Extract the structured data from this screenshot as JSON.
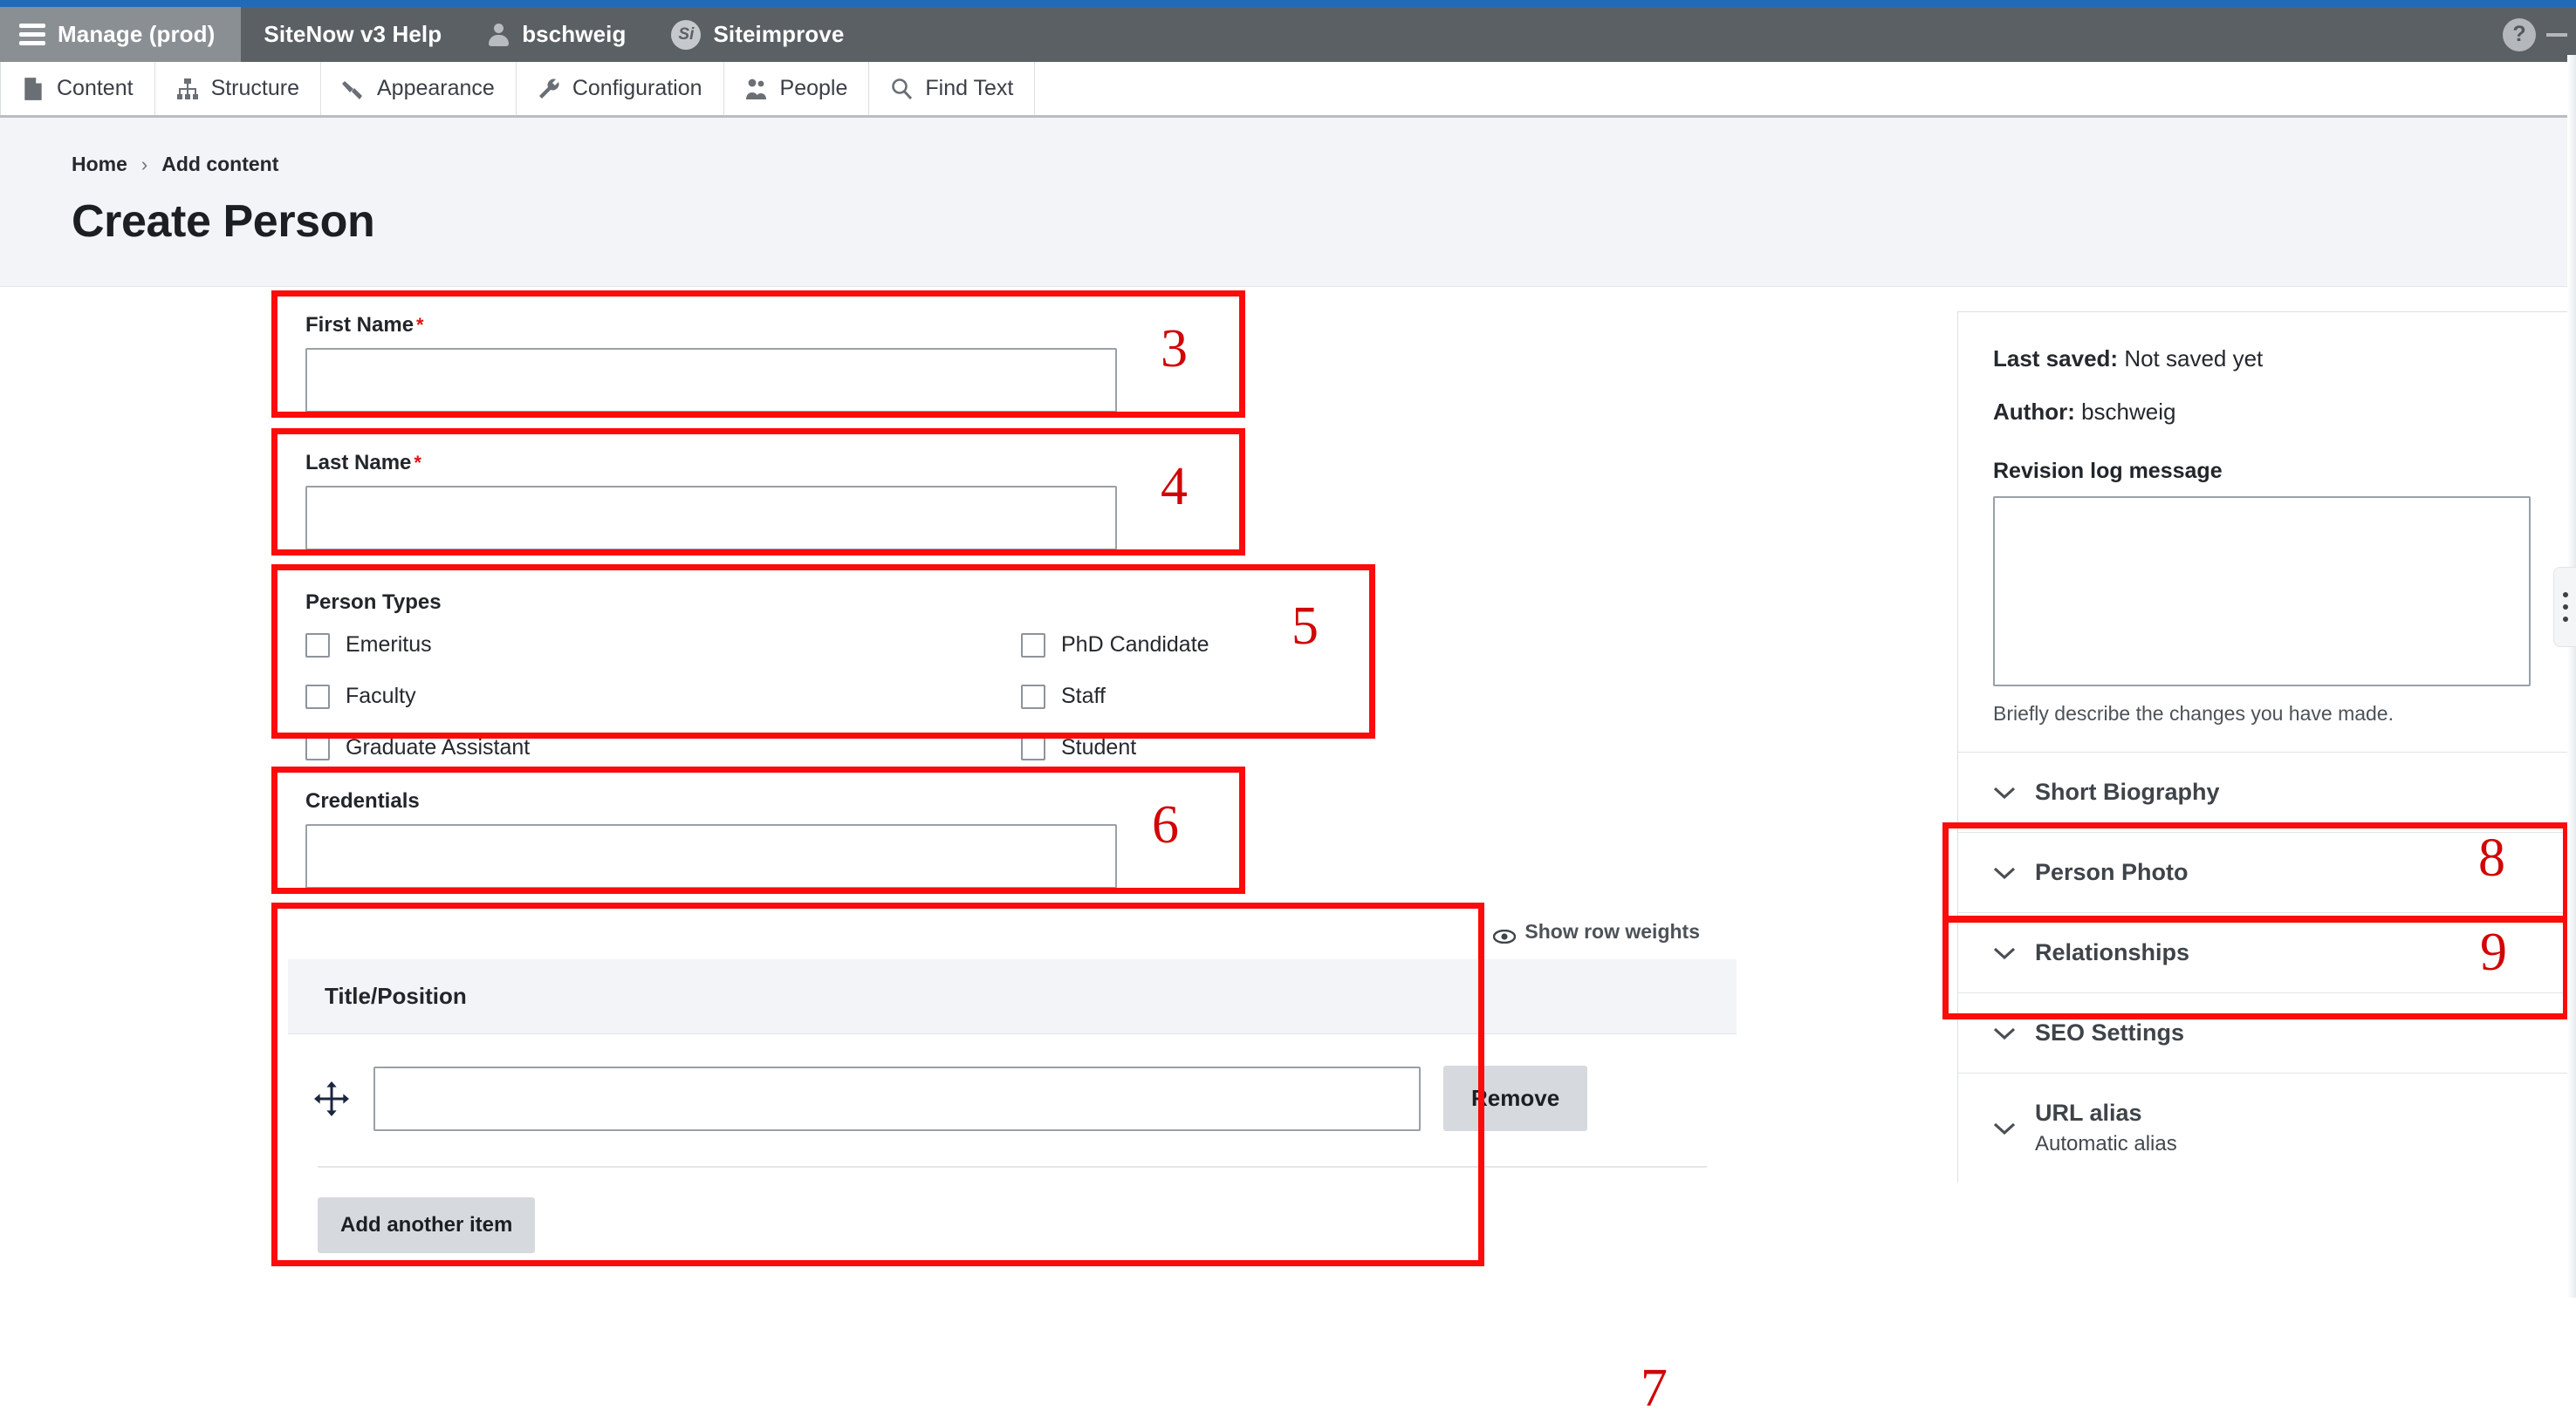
{
  "toolbar": {
    "home_label": "Manage (prod)",
    "items": [
      {
        "label": "SiteNow v3 Help",
        "icon": "none"
      },
      {
        "label": "bschweig",
        "icon": "user-icon"
      },
      {
        "label": "Siteimprove",
        "icon": "si-badge",
        "badge": "Si"
      }
    ],
    "help_label": "?"
  },
  "menu": {
    "items": [
      {
        "label": "Content",
        "icon": "document-icon"
      },
      {
        "label": "Structure",
        "icon": "sitemap-icon"
      },
      {
        "label": "Appearance",
        "icon": "paintbrush-icon"
      },
      {
        "label": "Configuration",
        "icon": "wrench-icon"
      },
      {
        "label": "People",
        "icon": "people-icon"
      },
      {
        "label": "Find Text",
        "icon": "search-icon"
      }
    ]
  },
  "header": {
    "breadcrumb": [
      {
        "label": "Home"
      },
      {
        "label": "Add content"
      }
    ],
    "breadcrumb_separator": "›",
    "title": "Create Person"
  },
  "form": {
    "first_name": {
      "label": "First Name",
      "required_marker": "*",
      "value": ""
    },
    "last_name": {
      "label": "Last Name",
      "required_marker": "*",
      "value": ""
    },
    "person_types": {
      "label": "Person Types",
      "column_one": [
        {
          "label": "Emeritus",
          "checked": false
        },
        {
          "label": "Faculty",
          "checked": false
        },
        {
          "label": "Graduate Assistant",
          "checked": false
        }
      ],
      "column_two": [
        {
          "label": "PhD Candidate",
          "checked": false
        },
        {
          "label": "Staff",
          "checked": false
        },
        {
          "label": "Student",
          "checked": false
        }
      ]
    },
    "credentials": {
      "label": "Credentials",
      "value": ""
    },
    "title_position": {
      "show_row_weights": "Show row weights",
      "column_header": "Title/Position",
      "row_value": "",
      "remove_label": "Remove",
      "add_label": "Add another item"
    }
  },
  "sidebar": {
    "last_saved_label": "Last saved:",
    "last_saved_value": "Not saved yet",
    "author_label": "Author:",
    "author_value": "bschweig",
    "revision_label": "Revision log message",
    "revision_value": "",
    "revision_help": "Briefly describe the changes you have made.",
    "accordions": [
      {
        "title": "Short Biography",
        "sub": ""
      },
      {
        "title": "Person Photo",
        "sub": ""
      },
      {
        "title": "Relationships",
        "sub": ""
      },
      {
        "title": "SEO Settings",
        "sub": ""
      },
      {
        "title": "URL alias",
        "sub": "Automatic alias"
      }
    ]
  },
  "annotations": {
    "accent_color": "#fc0b0b",
    "numbers": [
      "3",
      "4",
      "5",
      "6",
      "7",
      "8",
      "9"
    ]
  }
}
